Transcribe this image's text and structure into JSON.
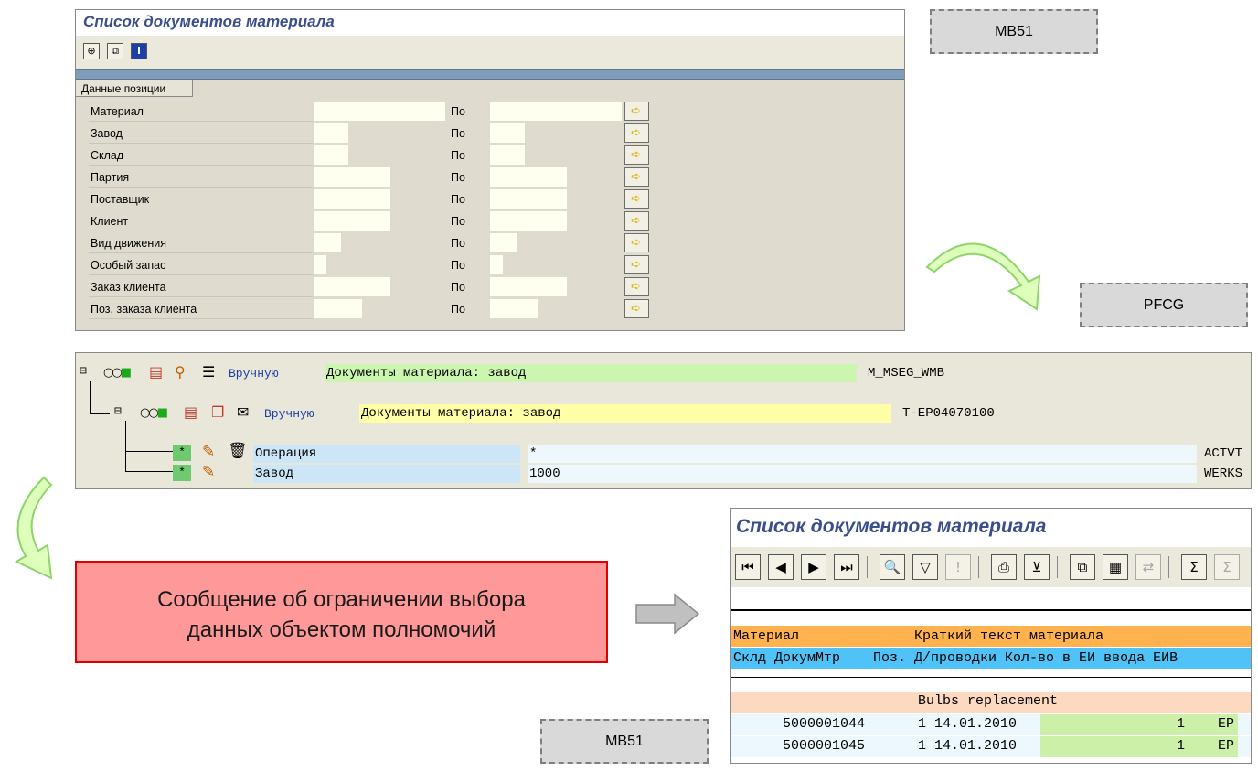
{
  "selection_screen": {
    "title": "Список документов материала",
    "group_tab": "Данные позиции",
    "to_label": "По",
    "rows": [
      {
        "label": "Материал"
      },
      {
        "label": "Завод"
      },
      {
        "label": "Склад"
      },
      {
        "label": "Партия"
      },
      {
        "label": "Поставщик"
      },
      {
        "label": "Клиент"
      },
      {
        "label": "Вид движения"
      },
      {
        "label": "Особый запас"
      },
      {
        "label": "Заказ клиента"
      },
      {
        "label": "Поз. заказа клиента"
      }
    ]
  },
  "tags": {
    "mb51_top": "MB51",
    "pfcg": "PFCG",
    "mb51_bottom": "MB51"
  },
  "role_tree": {
    "node1": {
      "status": "Вручную",
      "text": "Документы материала: завод",
      "object": "M_MSEG_WMB"
    },
    "node2": {
      "status": "Вручную",
      "text": "Документы материала: завод",
      "object": "T-EP04070100"
    },
    "fields": [
      {
        "name": "Операция",
        "value": "*",
        "tech": "ACTVT"
      },
      {
        "name": "Завод",
        "value": "1000",
        "tech": "WERKS"
      }
    ]
  },
  "message": {
    "line1": "Сообщение об ограничении выбора",
    "line2": "данных объектом полномочий"
  },
  "result_screen": {
    "title": "Список документов материала",
    "header1": "Материал              Краткий текст материала",
    "header2": "Склд ДокумМтр    Поз. Д/проводки Кол-во в ЕИ ввода ЕИВ",
    "group_text": "Bulbs replacement",
    "rows": [
      {
        "doc": "5000001044",
        "pos": "1",
        "date": "14.01.2010",
        "qty": "1",
        "unit": "EP"
      },
      {
        "doc": "5000001045",
        "pos": "1",
        "date": "14.01.2010",
        "qty": "1",
        "unit": "EP"
      }
    ]
  },
  "colors": {
    "sap_title": "#3a4e8c",
    "input_bg": "#fffff0",
    "header_orange": "#ffb24d",
    "header_blue": "#4fc3f7",
    "group_peach": "#fdd9bf",
    "green_cell": "#ccf0a8",
    "message_bg": "#ff9999",
    "message_border": "#e00000"
  }
}
